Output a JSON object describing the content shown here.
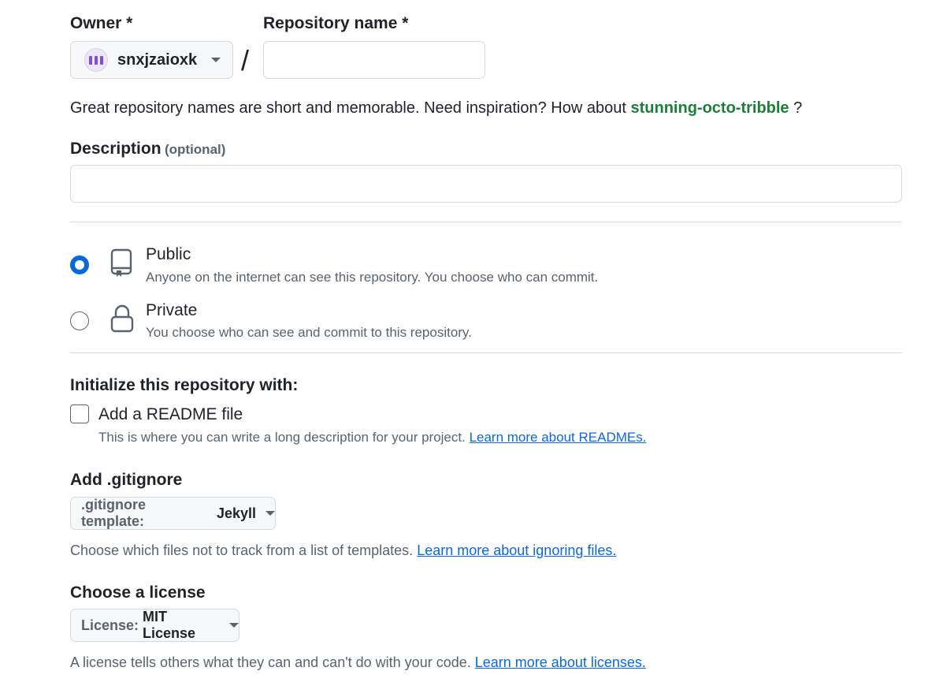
{
  "owner": {
    "label": "Owner *",
    "name": "snxjzaioxk"
  },
  "separator": "/",
  "repo_name": {
    "label": "Repository name *",
    "value": "",
    "placeholder": ""
  },
  "hint": {
    "text": "Great repository names are short and memorable. Need inspiration? How about",
    "suggestion": "stunning-octo-tribble",
    "suffix": "?"
  },
  "description": {
    "label": "Description",
    "optional": "(optional)",
    "value": ""
  },
  "visibility": {
    "selected": "Public",
    "options": [
      {
        "title": "Public",
        "desc": "Anyone on the internet can see this repository. You choose who can commit.",
        "icon": "repo-icon"
      },
      {
        "title": "Private",
        "desc": "You choose who can see and commit to this repository.",
        "icon": "lock-icon"
      }
    ]
  },
  "init": {
    "heading": "Initialize this repository with:",
    "readme_label": "Add a README file",
    "readme_checked": false,
    "readme_desc": "This is where you can write a long description for your project.",
    "readme_link": "Learn more about READMEs."
  },
  "gitignore": {
    "heading": "Add .gitignore",
    "prefix": ".gitignore template:",
    "value": "Jekyll",
    "desc": "Choose which files not to track from a list of templates.",
    "link": "Learn more about ignoring files."
  },
  "license": {
    "heading": "Choose a license",
    "prefix": "License:",
    "value": "MIT License",
    "desc": "A license tells others what they can and can't do with your code.",
    "link": "Learn more about licenses."
  },
  "colors": {
    "accent": "#0969da",
    "suggestion": "#1a7f37",
    "muted": "#59636e",
    "border": "#d1d9e0"
  }
}
